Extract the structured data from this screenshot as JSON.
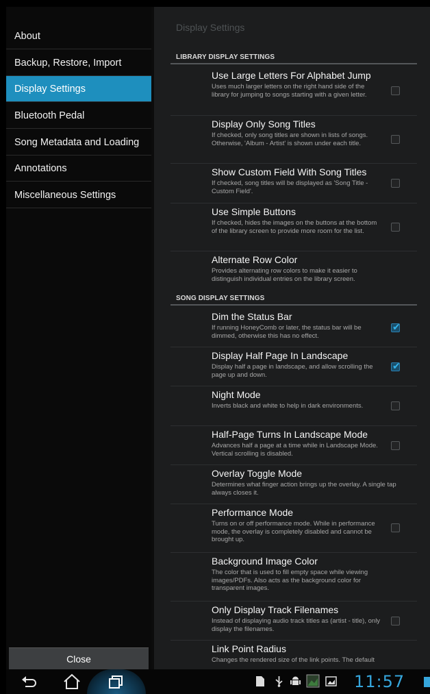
{
  "sidebar": {
    "items": [
      {
        "label": "About",
        "selected": false
      },
      {
        "label": "Backup, Restore, Import",
        "selected": false
      },
      {
        "label": "Display Settings",
        "selected": true
      },
      {
        "label": "Bluetooth Pedal",
        "selected": false
      },
      {
        "label": "Song Metadata and Loading",
        "selected": false
      },
      {
        "label": "Annotations",
        "selected": false
      },
      {
        "label": "Miscellaneous Settings",
        "selected": false
      }
    ],
    "close_label": "Close"
  },
  "main": {
    "title": "Display Settings",
    "sections": [
      {
        "header": "LIBRARY DISPLAY SETTINGS",
        "prefs": [
          {
            "title": "Use Large Letters For Alphabet Jump",
            "desc": "Uses much larger letters on the right hand side of the library for jumping to songs starting with a given letter.",
            "checkbox": true,
            "checked": false
          },
          {
            "title": "Display Only Song Titles",
            "desc": "If checked, only song titles are shown in lists of songs. Otherwise, 'Album - Artist' is shown under each title.",
            "checkbox": true,
            "checked": false
          },
          {
            "title": "Show Custom Field With Song Titles",
            "desc": "If checked, song titles will be displayed as 'Song Title - Custom Field'.",
            "checkbox": true,
            "checked": false
          },
          {
            "title": "Use Simple Buttons",
            "desc": "If checked, hides the images on the buttons at the bottom of the library screen to provide more room for the list.",
            "checkbox": true,
            "checked": false
          },
          {
            "title": "Alternate Row Color",
            "desc": "Provides alternating row colors to make it easier to distinguish individual entries on the library screen.",
            "checkbox": false,
            "checked": false
          }
        ]
      },
      {
        "header": "SONG DISPLAY SETTINGS",
        "prefs": [
          {
            "title": "Dim the Status Bar",
            "desc": "If running HoneyComb or later, the status bar will be dimmed, otherwise this has no effect.",
            "checkbox": true,
            "checked": true
          },
          {
            "title": "Display Half Page In Landscape",
            "desc": "Display half a page in landscape, and allow scrolling the page up and down.",
            "checkbox": true,
            "checked": true
          },
          {
            "title": "Night Mode",
            "desc": "Inverts black and white to help in dark environments.",
            "checkbox": true,
            "checked": false
          },
          {
            "title": "Half-Page Turns In Landscape Mode",
            "desc": "Advances half a page at a time while in Landscape Mode. Vertical scrolling is disabled.",
            "checkbox": true,
            "checked": false
          },
          {
            "title": "Overlay Toggle Mode",
            "desc": "Determines what finger action brings up the overlay. A single tap always closes it.",
            "checkbox": false,
            "checked": false
          },
          {
            "title": "Performance Mode",
            "desc": "Turns on or off performance mode. While in performance mode, the overlay is completely disabled and cannot be brought up.",
            "checkbox": true,
            "checked": false
          },
          {
            "title": "Background Image Color",
            "desc": "The color that is used to fill empty space while viewing images/PDFs. Also acts as the background color for transparent images.",
            "checkbox": false,
            "checked": false
          },
          {
            "title": "Only Display Track Filenames",
            "desc": "Instead of displaying audio track titles as (artist - title), only display the filenames.",
            "checkbox": true,
            "checked": false
          },
          {
            "title": "Link Point Radius",
            "desc": "Changes the rendered size of the link points. The default",
            "checkbox": false,
            "checked": false
          }
        ]
      }
    ]
  },
  "statusbar": {
    "clock": "11:57",
    "accent": "#36a6dc",
    "icons": [
      "sd-card-icon",
      "usb-icon",
      "android-debug-icon",
      "image-icon",
      "picture-icon",
      "battery-icon"
    ]
  },
  "navbar": {
    "icons": [
      "back-icon",
      "home-icon",
      "recent-apps-icon"
    ]
  },
  "colors": {
    "selected": "#1e8fbe",
    "checkmark": "#34b2ea"
  }
}
